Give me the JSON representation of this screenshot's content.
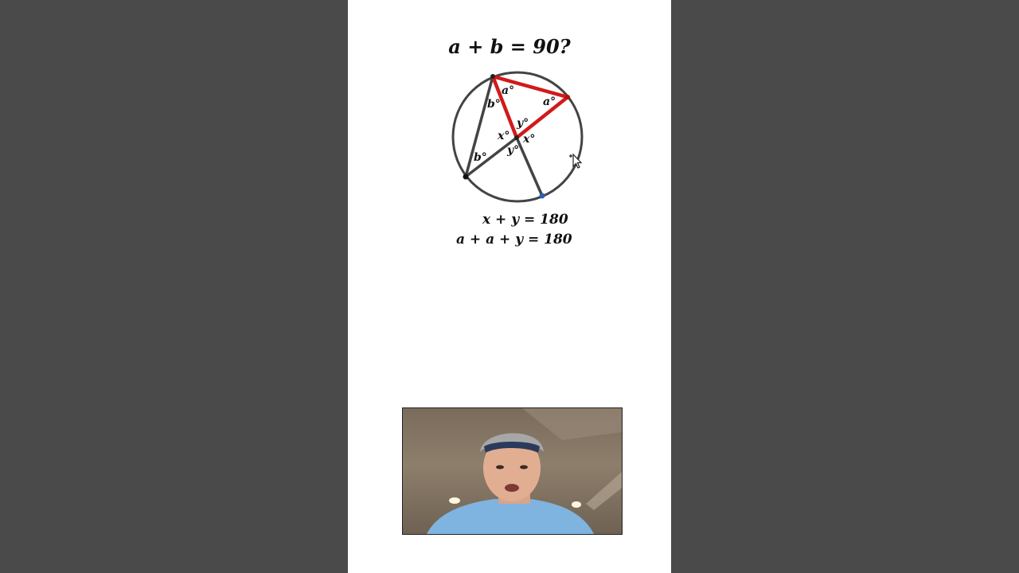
{
  "title": "a + b = 90?",
  "equations": [
    "x + y = 180",
    "a + a + y = 180"
  ],
  "angle_labels": {
    "a_top": "a°",
    "a_right": "a°",
    "b_top": "b°",
    "b_bottom": "b°",
    "x_left": "x°",
    "x_right": "x°",
    "y_top": "y°",
    "y_bottom": "y°"
  },
  "colors": {
    "triangle": "#d11a1a",
    "lines": "#444444",
    "circle": "#444444",
    "background": "#4a4a4a",
    "canvas": "#ffffff",
    "point_blue": "#2f5fb3"
  },
  "icons": {
    "cursor": "move-cursor-icon",
    "webcam": "presenter-video"
  }
}
